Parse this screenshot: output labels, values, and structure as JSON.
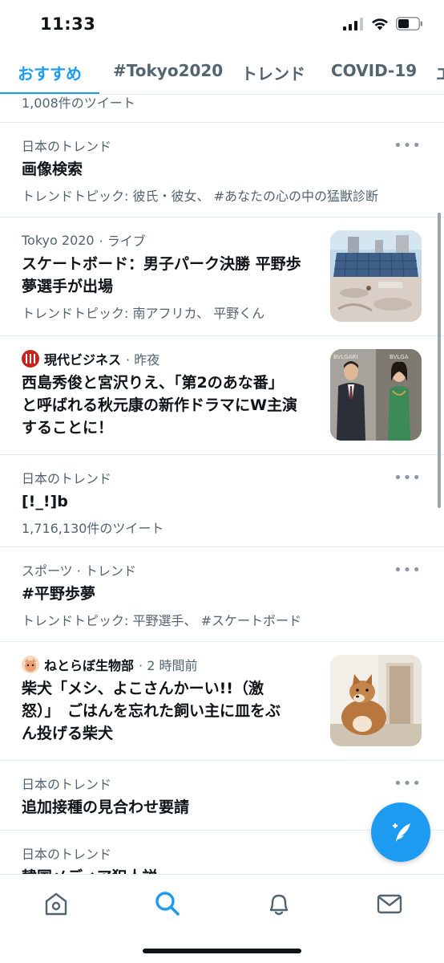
{
  "status_bar": {
    "time": "11:33"
  },
  "tabs": [
    {
      "label": "おすすめ",
      "active": true
    },
    {
      "label": "#Tokyo2020",
      "active": false
    },
    {
      "label": "トレンド",
      "active": false
    },
    {
      "label": "COVID-19",
      "active": false
    },
    {
      "label": "エ",
      "active": false
    }
  ],
  "feed": {
    "partial_top": {
      "count": "1,008件のツイート"
    },
    "trend1": {
      "category": "日本のトレンド",
      "title": "画像検索",
      "subtitle": "トレンドトピック: 彼氏・彼女、 #あなたの心の中の猛獣診断"
    },
    "story1": {
      "source": "Tokyo 2020",
      "time": "· ライブ",
      "title_line1": "スケートボード：男子パーク決勝 平野歩",
      "title_line2": "夢選手が出場",
      "subtitle": "トレンドトピック: 南アフリカ、 平野くん"
    },
    "story2": {
      "source": "現代ビジネス",
      "time": "· 昨夜",
      "title_line1": "西島秀俊と宮沢りえ、「第2のあな番」",
      "title_line2": "と呼ばれる秋元康の新作ドラマにW主演",
      "title_line3": "することに！",
      "thumb_text_left": "BVLGARI",
      "thumb_text_right": "BVLGA"
    },
    "trend2": {
      "category": "日本のトレンド",
      "title": "[!_!]b",
      "subtitle": "1,716,130件のツイート"
    },
    "trend3": {
      "category": "スポーツ · トレンド",
      "title": "#平野歩夢",
      "subtitle": "トレンドトピック: 平野選手、 #スケートボード"
    },
    "story3": {
      "source": "ねとらぼ生物部",
      "time": "· 2 時間前",
      "title_line1": "柴犬「メシ、よこさんかーい!!（激",
      "title_line2": "怒）」　ごはんを忘れた飼い主に皿をぶ",
      "title_line3": "ん投げる柴犬"
    },
    "trend4": {
      "category": "日本のトレンド",
      "title": "追加接種の見合わせ要請"
    },
    "trend5": {
      "category": "日本のトレンド",
      "title": "韓国メディア犯人説"
    }
  },
  "colors": {
    "accent": "#1d9bf0",
    "text": "#0f1419",
    "muted": "#536471",
    "divider": "#e6ecf0"
  },
  "icons": [
    "signal-icon",
    "wifi-icon",
    "battery-icon",
    "more-icon",
    "compose-tweet-icon",
    "home-icon",
    "search-icon",
    "notifications-icon",
    "messages-icon"
  ]
}
